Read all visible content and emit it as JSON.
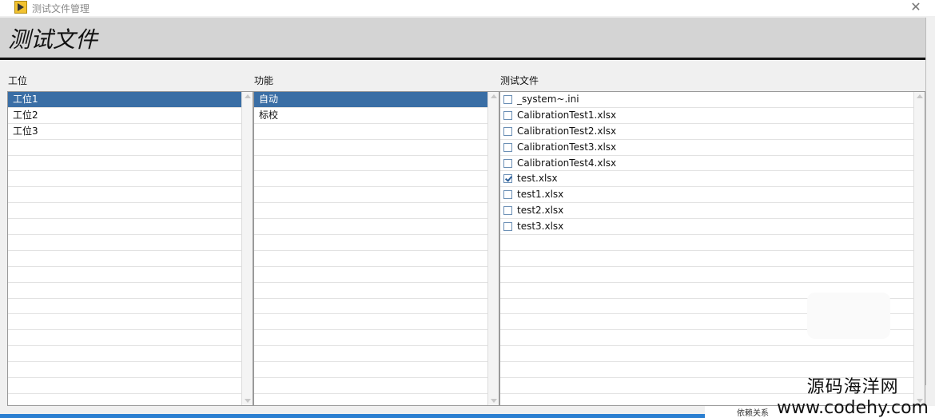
{
  "window": {
    "title": "测试文件管理"
  },
  "header": {
    "title": "测试文件"
  },
  "stations": {
    "label": "工位",
    "items": [
      "工位1",
      "工位2",
      "工位3"
    ],
    "selected": 0
  },
  "functions": {
    "label": "功能",
    "items": [
      "自动",
      "标校"
    ],
    "selected": 0
  },
  "files": {
    "label": "测试文件",
    "items": [
      {
        "name": "_system~.ini",
        "checked": false
      },
      {
        "name": "CalibrationTest1.xlsx",
        "checked": false
      },
      {
        "name": "CalibrationTest2.xlsx",
        "checked": false
      },
      {
        "name": "CalibrationTest3.xlsx",
        "checked": false
      },
      {
        "name": "CalibrationTest4.xlsx",
        "checked": false
      },
      {
        "name": "test.xlsx",
        "checked": true
      },
      {
        "name": "test1.xlsx",
        "checked": false
      },
      {
        "name": "test2.xlsx",
        "checked": false
      },
      {
        "name": "test3.xlsx",
        "checked": false
      }
    ]
  },
  "watermark": {
    "line1": "源码海洋网",
    "line2": "www.codehy.com"
  },
  "footer": {
    "text": "依赖关系"
  },
  "colors": {
    "selection": "#3a6ea5",
    "header_bg": "#d4d4d4",
    "desktop": "#2b7fd1"
  }
}
